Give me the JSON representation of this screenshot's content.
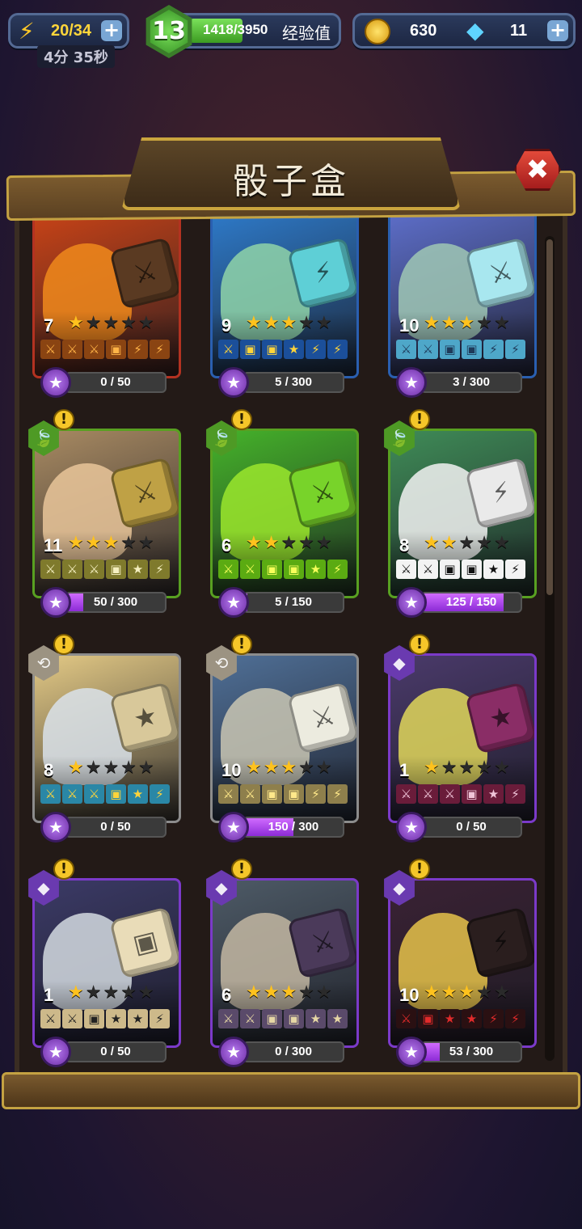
{
  "hud": {
    "energy": "20/34",
    "energy_timer": "4分 35秒",
    "level": "13",
    "xp": "1418/3950",
    "xp_label": "经验值",
    "xp_fraction": 0.36,
    "coins": "630",
    "gems": "11",
    "plus": "+"
  },
  "dialog": {
    "title": "骰子盒",
    "close": "✖"
  },
  "cards": [
    {
      "level": "7",
      "stars": 1,
      "max_stars": 5,
      "progress": "0 / 50",
      "fraction": 0.0,
      "border": "#b33221",
      "bg": "#c94317",
      "monster": "#f08a1c",
      "dice": "#5a3a22",
      "face_bg": "#8a4412",
      "face_fg": "#ffb347",
      "faces": [
        "⚔",
        "⚔",
        "⚔",
        "▣",
        "⚡",
        "⚡"
      ],
      "dice_glyph": "⚔",
      "faction": null,
      "alert": false
    },
    {
      "level": "9",
      "stars": 3,
      "max_stars": 5,
      "progress": "5 / 300",
      "fraction": 0.02,
      "border": "#2a5fb0",
      "bg": "#2e7ac9",
      "monster": "#8fd4a8",
      "dice": "#5ecfd6",
      "face_bg": "#1b4f9a",
      "face_fg": "#ffd43a",
      "faces": [
        "⚔",
        "▣",
        "▣",
        "★",
        "⚡",
        "⚡"
      ],
      "dice_glyph": "⚡",
      "faction": null,
      "alert": false
    },
    {
      "level": "10",
      "stars": 3,
      "max_stars": 5,
      "progress": "3 / 300",
      "fraction": 0.01,
      "border": "#2a5fb0",
      "bg": "#5d6ec9",
      "monster": "#9fc7b4",
      "dice": "#a8e7ef",
      "face_bg": "#4ea7c9",
      "face_fg": "#1e3b5a",
      "faces": [
        "⚔",
        "⚔",
        "▣",
        "▣",
        "⚡",
        "⚡"
      ],
      "dice_glyph": "⚔",
      "faction": null,
      "alert": false
    },
    {
      "level": "11",
      "stars": 3,
      "max_stars": 5,
      "progress": "50 / 300",
      "fraction": 0.17,
      "border": "#58a021",
      "bg": "#a88a62",
      "monster": "#e9c59a",
      "dice": "#bfa145",
      "face_bg": "#7f7a2c",
      "face_fg": "#f5f0c0",
      "faces": [
        "⚔",
        "⚔",
        "⚔",
        "▣",
        "★",
        "⚡"
      ],
      "dice_glyph": "⚔",
      "faction": "🍃",
      "faction_color": "#4e9a25",
      "alert": true
    },
    {
      "level": "6",
      "stars": 2,
      "max_stars": 5,
      "progress": "5 / 150",
      "fraction": 0.03,
      "border": "#58a021",
      "bg": "#45b22a",
      "monster": "#9be62d",
      "dice": "#78d32a",
      "face_bg": "#5bab12",
      "face_fg": "#f7ff5a",
      "faces": [
        "⚔",
        "⚔",
        "▣",
        "▣",
        "★",
        "⚡"
      ],
      "dice_glyph": "⚔",
      "faction": "🍃",
      "faction_color": "#4e9a25",
      "alert": true
    },
    {
      "level": "8",
      "stars": 2,
      "max_stars": 5,
      "progress": "125 / 150",
      "fraction": 0.83,
      "border": "#58a021",
      "bg": "#3f8b57",
      "monster": "#f2f2f2",
      "dice": "#eaeaea",
      "face_bg": "#f3f3f3",
      "face_fg": "#111111",
      "faces": [
        "⚔",
        "⚔",
        "▣",
        "▣",
        "★",
        "⚡"
      ],
      "dice_glyph": "⚡",
      "faction": "🍃",
      "faction_color": "#4e9a25",
      "alert": true
    },
    {
      "level": "8",
      "stars": 1,
      "max_stars": 5,
      "progress": "0 / 50",
      "fraction": 0.0,
      "border": "#8c8c8c",
      "bg": "#e3c985",
      "monster": "#d9e2ea",
      "dice": "#d8c89a",
      "face_bg": "#2a87a6",
      "face_fg": "#ffd43a",
      "faces": [
        "⚔",
        "⚔",
        "⚔",
        "▣",
        "★",
        "⚡"
      ],
      "dice_glyph": "★",
      "faction": "⟲",
      "faction_color": "#9c9382",
      "alert": true
    },
    {
      "level": "10",
      "stars": 3,
      "max_stars": 5,
      "progress": "150 / 300",
      "fraction": 0.5,
      "border": "#8c8c8c",
      "bg": "#4f6f96",
      "monster": "#c9c5b3",
      "dice": "#ecebdf",
      "face_bg": "#8e7f4c",
      "face_fg": "#ffe88a",
      "faces": [
        "⚔",
        "⚔",
        "▣",
        "▣",
        "⚡",
        "⚡"
      ],
      "dice_glyph": "⚔",
      "faction": "⟲",
      "faction_color": "#9c9382",
      "alert": true
    },
    {
      "level": "1",
      "stars": 1,
      "max_stars": 5,
      "progress": "0 / 50",
      "fraction": 0.0,
      "border": "#7b3ac9",
      "bg": "#4a3a6a",
      "monster": "#e0d75a",
      "dice": "#8a2d66",
      "face_bg": "#6a1c3a",
      "face_fg": "#f0c4d8",
      "faces": [
        "⚔",
        "⚔",
        "⚔",
        "▣",
        "★",
        "⚡"
      ],
      "dice_glyph": "★",
      "faction": "◆",
      "faction_color": "#6a3ab0",
      "alert": true
    },
    {
      "level": "1",
      "stars": 1,
      "max_stars": 5,
      "progress": "0 / 50",
      "fraction": 0.0,
      "border": "#7b3ac9",
      "bg": "#3b3a66",
      "monster": "#d3dbe0",
      "dice": "#e9dcb8",
      "face_bg": "#cdb98a",
      "face_fg": "#222222",
      "faces": [
        "⚔",
        "⚔",
        "▣",
        "★",
        "★",
        "⚡"
      ],
      "dice_glyph": "▣",
      "faction": "◆",
      "faction_color": "#6a3ab0",
      "alert": true
    },
    {
      "level": "6",
      "stars": 3,
      "max_stars": 5,
      "progress": "0 / 300",
      "fraction": 0.0,
      "border": "#7b3ac9",
      "bg": "#4d5a66",
      "monster": "#c3b7a2",
      "dice": "#4b3a5a",
      "face_bg": "#5a4a6a",
      "face_fg": "#e6d7a5",
      "faces": [
        "⚔",
        "⚔",
        "▣",
        "▣",
        "★",
        "★"
      ],
      "dice_glyph": "⚔",
      "faction": "◆",
      "faction_color": "#6a3ab0",
      "alert": true
    },
    {
      "level": "10",
      "stars": 3,
      "max_stars": 5,
      "progress": "53 / 300",
      "fraction": 0.18,
      "border": "#7b3ac9",
      "bg": "#3a2234",
      "monster": "#e6c34a",
      "dice": "#2a1e1e",
      "face_bg": "#2a1012",
      "face_fg": "#e12b2b",
      "faces": [
        "⚔",
        "▣",
        "★",
        "★",
        "⚡",
        "⚡"
      ],
      "dice_glyph": "⚡",
      "faction": "◆",
      "faction_color": "#6a3ab0",
      "alert": true
    }
  ]
}
